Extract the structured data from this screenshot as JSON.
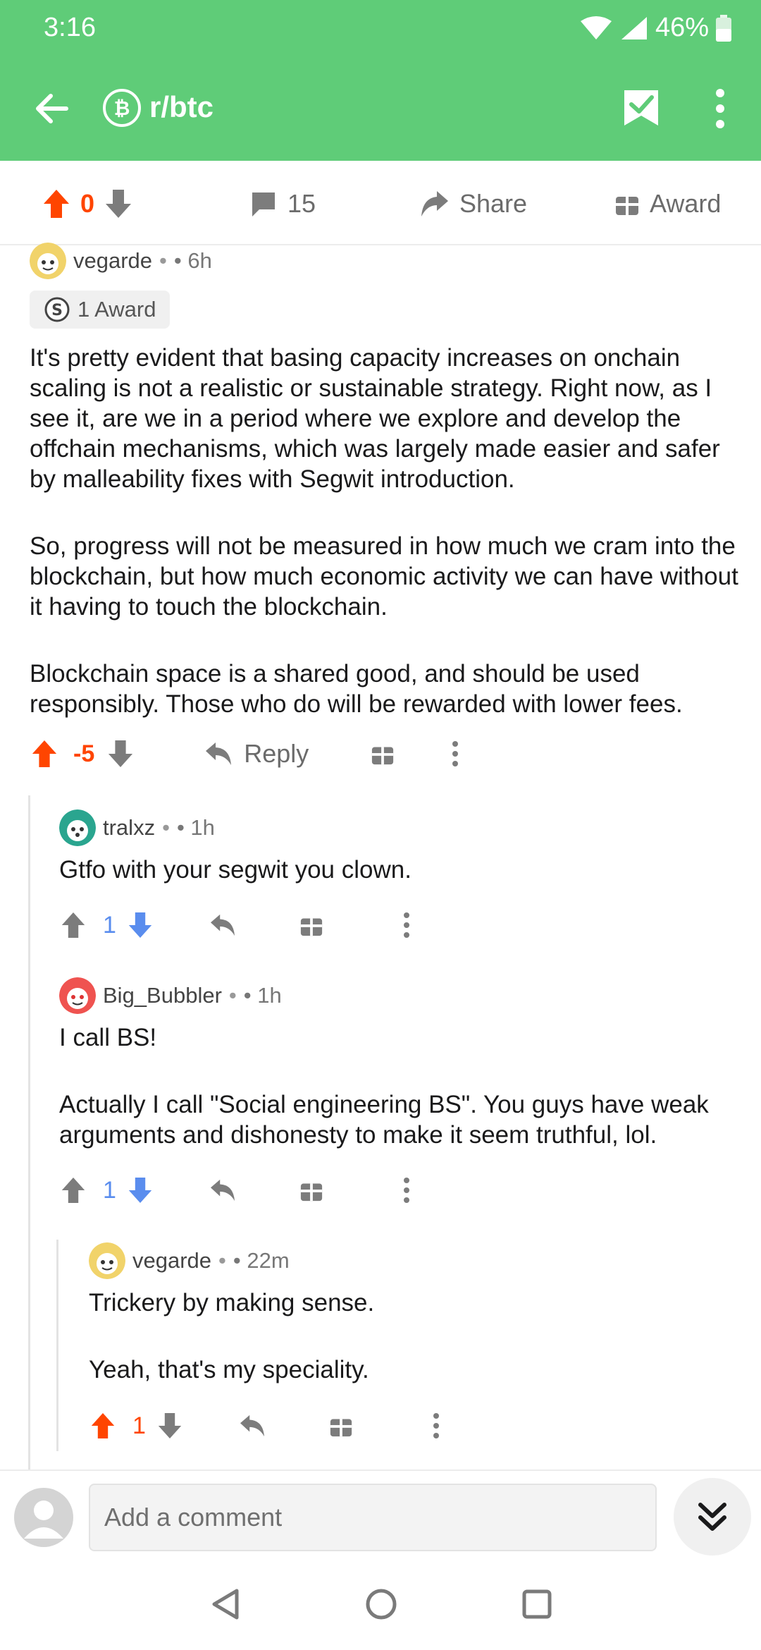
{
  "status": {
    "time": "3:16",
    "battery": "46%"
  },
  "toolbar": {
    "subreddit": "r/btc"
  },
  "post_actions": {
    "score": "0",
    "comments": "15",
    "share_label": "Share",
    "award_label": "Award"
  },
  "comments": [
    {
      "author": "vegarde",
      "time": "• 6h",
      "sep": "•",
      "award": "1 Award",
      "paragraphs": [
        "It's pretty evident that basing capacity increases on onchain scaling is not a realistic or sustainable strategy. Right now, as I see it, are we in a period where we explore and develop the offchain mechanisms, which was largely made easier and safer by malleability fixes with Segwit introduction.",
        "So, progress will not be measured in how much we cram into the blockchain, but how much economic activity we can have without it having to touch the blockchain.",
        "Blockchain space is a shared good, and should be used responsibly. Those who do will be rewarded with lower fees."
      ],
      "score": "-5",
      "reply_label": "Reply"
    },
    {
      "author": "tralxz",
      "time": "• 1h",
      "sep": "•",
      "paragraphs": [
        "Gtfo with your segwit you clown."
      ],
      "score": "1"
    },
    {
      "author": "Big_Bubbler",
      "time": "• 1h",
      "sep": "•",
      "paragraphs": [
        "I call BS!",
        "Actually I call \"Social engineering BS\". You guys have weak arguments and dishonesty to make it seem truthful, lol."
      ],
      "score": "1"
    },
    {
      "author": "vegarde",
      "time": "• 22m",
      "sep": "•",
      "paragraphs": [
        "Trickery by making sense.",
        "Yeah, that's my speciality."
      ],
      "score": "1"
    }
  ],
  "composer": {
    "placeholder": "Add a comment"
  },
  "colors": {
    "header": "#5fcc78",
    "upvote": "#ff4500",
    "downvote_active": "#5a8dee",
    "neutral": "#7c7c7c"
  }
}
